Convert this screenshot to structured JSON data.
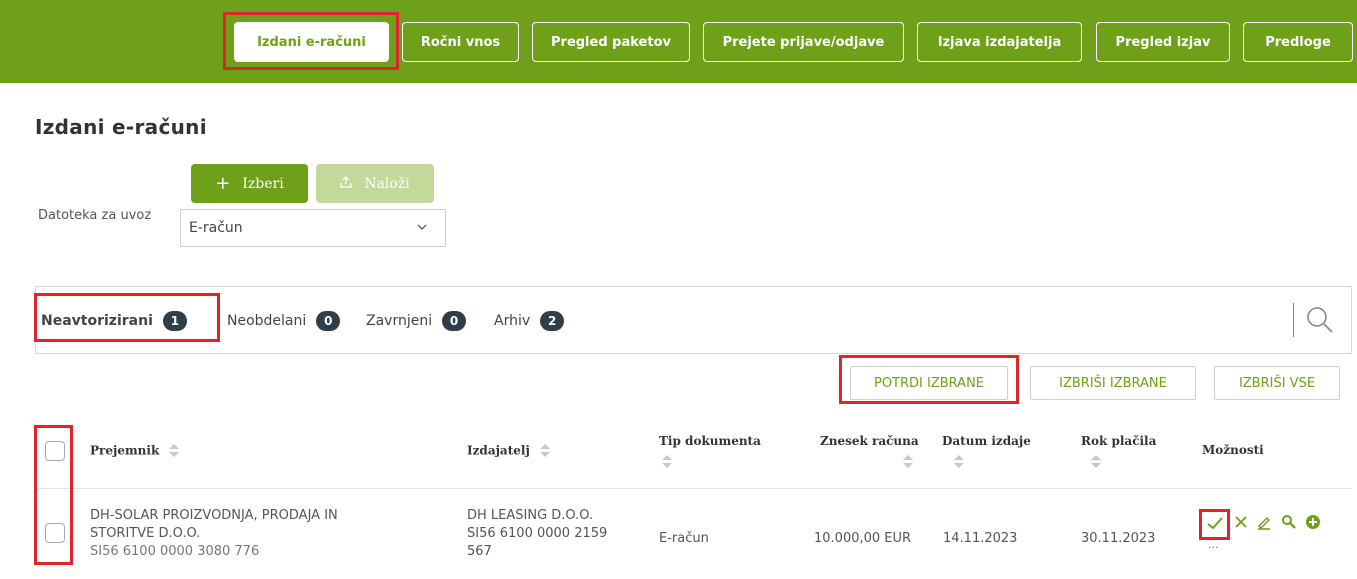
{
  "nav": {
    "items": [
      {
        "label": "Izdani e-računi",
        "active": true
      },
      {
        "label": "Ročni vnos"
      },
      {
        "label": "Pregled paketov"
      },
      {
        "label": "Prejete prijave/odjave"
      },
      {
        "label": "Izjava izdajatelja"
      },
      {
        "label": "Pregled izjav"
      },
      {
        "label": "Predloge"
      }
    ]
  },
  "page": {
    "title": "Izdani e-računi"
  },
  "upload": {
    "choose_label": "Izberi",
    "upload_label": "Naloži",
    "file_label": "Datoteka za uvoz",
    "file_type_value": "E-račun"
  },
  "tabs": [
    {
      "label": "Neavtorizirani",
      "count": "1",
      "active": true
    },
    {
      "label": "Neobdelani",
      "count": "0"
    },
    {
      "label": "Zavrnjeni",
      "count": "0"
    },
    {
      "label": "Arhiv",
      "count": "2"
    }
  ],
  "actions": {
    "confirm_selected": "POTRDI IZBRANE",
    "delete_selected": "IZBRIŠI IZBRANE",
    "delete_all": "IZBRIŠI VSE"
  },
  "table": {
    "headers": {
      "recipient": "Prejemnik",
      "issuer": "Izdajatelj",
      "doc_type": "Tip dokumenta",
      "amount": "Znesek računa",
      "issue_date": "Datum izdaje",
      "due_date": "Rok plačila",
      "options": "Možnosti"
    },
    "rows": [
      {
        "recipient_line1": "DH-SOLAR PROIZVODNJA, PRODAJA IN",
        "recipient_line2": "STORITVE D.O.O.",
        "recipient_iban": "SI56 6100 0000 3080 776",
        "issuer_line1": "DH LEASING D.O.O.",
        "issuer_line2": "SI56 6100 0000 2159",
        "issuer_line3": "567",
        "doc_type": "E-račun",
        "amount": "10.000,00 EUR",
        "issue_date": "14.11.2023",
        "due_date": "30.11.2023",
        "more": "..."
      }
    ]
  },
  "colors": {
    "brand": "#6fa01a",
    "highlight": "#e0242b",
    "badge": "#2f3f49"
  }
}
